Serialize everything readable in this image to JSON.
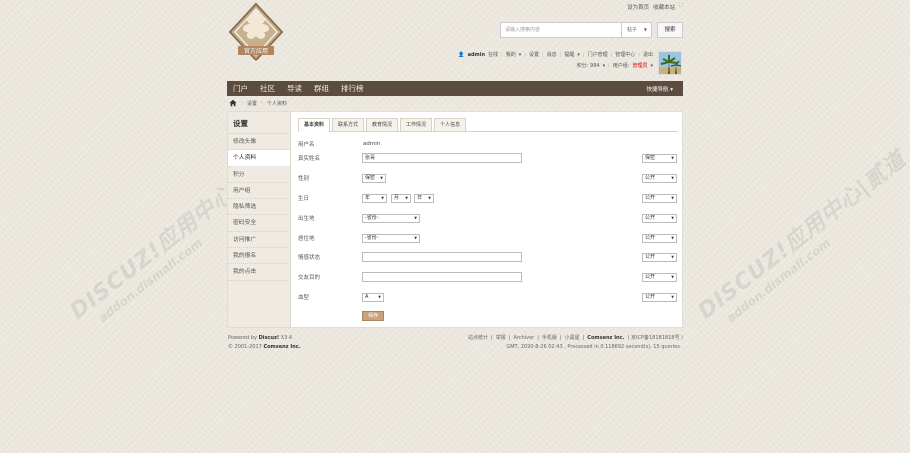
{
  "top_links": [
    "设为首页",
    "收藏本站"
  ],
  "logo": {
    "text_top": "官方应用",
    "text_bottom": "APP"
  },
  "search": {
    "placeholder": "请输入搜索内容",
    "type": "帖子",
    "button": "搜索"
  },
  "user": {
    "name": "admin",
    "status": "在线",
    "links": [
      "我的",
      "设置",
      "消息",
      "提醒",
      "门户管理",
      "管理中心",
      "退出"
    ],
    "points_label": "积分: 994",
    "group_label": "用户组:",
    "group_value": "管理员"
  },
  "nav": {
    "items": [
      "门户",
      "社区",
      "导读",
      "群组",
      "排行榜"
    ],
    "quick": "快捷导航"
  },
  "breadcrumb": [
    "设置",
    "个人资料"
  ],
  "sidebar": {
    "title": "设置",
    "items": [
      "修改头像",
      "个人资料",
      "积分",
      "用户组",
      "隐私筛选",
      "密码安全",
      "访问推广",
      "我的报名",
      "我的点击"
    ]
  },
  "tabs": [
    "基本资料",
    "联系方式",
    "教育情况",
    "工作情况",
    "个人信息"
  ],
  "form": {
    "username_label": "用户名",
    "username_value": "admin",
    "realname_label": "真实姓名",
    "realname_value": "张哥",
    "realname_privacy": "保密",
    "gender_label": "性别",
    "gender_value": "保密",
    "gender_privacy": "公开",
    "birthday_label": "生日",
    "birth_year": "年",
    "birth_month": "月",
    "birth_day": "日",
    "birthday_privacy": "公开",
    "birthplace_label": "出生地",
    "birthplace_value": "-省份-",
    "birthplace_privacy": "公开",
    "residence_label": "居住地",
    "residence_value": "-省份-",
    "residence_privacy": "公开",
    "marital_label": "情感状态",
    "marital_privacy": "公开",
    "purpose_label": "交友目的",
    "purpose_privacy": "公开",
    "blood_label": "血型",
    "blood_value": "A",
    "blood_privacy": "公开",
    "submit": "保存"
  },
  "footer": {
    "powered_prefix": "Powered by",
    "powered_brand": "Discuz!",
    "powered_version": "X3.4",
    "copyright_prefix": "© 2001-2017",
    "copyright_brand": "Comsenz Inc.",
    "links": [
      "站点统计",
      "举报",
      "Archiver",
      "手机版",
      "小黑屋"
    ],
    "company": "Comsenz Inc.",
    "icp": "( 京ICP备18181818号 )",
    "gmt": "GMT, 2020-8-26 02:43 , Processed in 0.118692 second(s), 15 queries ."
  },
  "watermark": {
    "line1": "DISCUZ!应用中心|贰道",
    "line2": "addon.dismall.com"
  },
  "colors": {
    "nav_bg": "#5b4c3e",
    "accent_red": "#cc0000",
    "submit": "#c9a27a"
  }
}
